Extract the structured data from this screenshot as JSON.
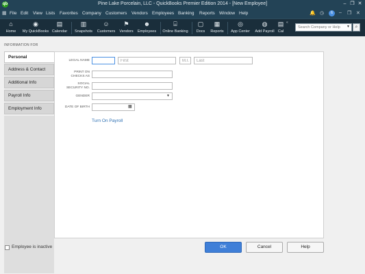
{
  "window": {
    "title": "Pine Lake Porcelain, LLC  -  QuickBooks Premier Edition 2014 - [New Employee]",
    "logo_text": "qb",
    "minimize": "–",
    "restore": "❐",
    "close": "✕"
  },
  "menu": {
    "items": [
      "File",
      "Edit",
      "View",
      "Lists",
      "Favorites",
      "Company",
      "Customers",
      "Vendors",
      "Employees",
      "Banking",
      "Reports",
      "Window",
      "Help"
    ],
    "badge": "6"
  },
  "toolbar": {
    "tools": [
      {
        "label": "Home",
        "icon": "home-icon"
      },
      {
        "label": "My QuickBooks",
        "icon": "quickbooks-icon"
      },
      {
        "label": "Calendar",
        "icon": "calendar-icon"
      },
      {
        "label": "Snapshots",
        "icon": "snapshots-icon"
      },
      {
        "label": "Customers",
        "icon": "customers-icon"
      },
      {
        "label": "Vendors",
        "icon": "vendors-icon"
      },
      {
        "label": "Employees",
        "icon": "employees-icon"
      },
      {
        "label": "Online Banking",
        "icon": "online-banking-icon"
      },
      {
        "label": "Docs",
        "icon": "docs-icon"
      },
      {
        "label": "Reports",
        "icon": "reports-icon"
      },
      {
        "label": "App Center",
        "icon": "app-center-icon"
      },
      {
        "label": "Add Payroll",
        "icon": "add-payroll-icon"
      },
      {
        "label": "Cal",
        "icon": "cal-icon"
      }
    ],
    "search_placeholder": "Search Company or Help"
  },
  "form": {
    "info_for": "INFORMATION FOR",
    "tabs": [
      "Personal",
      "Address & Contact",
      "Additional Info",
      "Payroll Info",
      "Employment Info"
    ],
    "active_tab": "Personal",
    "labels": {
      "legal_name": "LEGAL NAME",
      "print_on_checks_1": "PRINT ON",
      "print_on_checks_2": "CHECKS AS",
      "ssn_1": "SOCIAL",
      "ssn_2": "SECURITY NO.",
      "gender": "GENDER",
      "dob": "DATE OF BIRTH"
    },
    "placeholders": {
      "first": "First",
      "mi": "M.I.",
      "last": "Last"
    },
    "turn_on_payroll": "Turn On Payroll",
    "inactive_label": "Employee is inactive"
  },
  "buttons": {
    "ok": "OK",
    "cancel": "Cancel",
    "help": "Help"
  },
  "colors": {
    "titlebar": "#234356",
    "iconbar": "#1a2e3b",
    "primary_button": "#3f7fd8",
    "link": "#2c6fb2"
  }
}
